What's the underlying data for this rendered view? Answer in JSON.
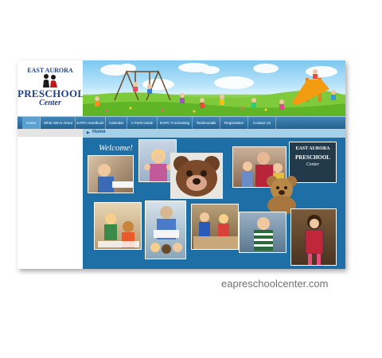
{
  "logo": {
    "line1": "EAST AURORA",
    "line2": "PRESCHOOL",
    "line3": "Center"
  },
  "nav": {
    "items": [
      {
        "label": "Home"
      },
      {
        "label": "What We're About"
      },
      {
        "label": "EAPC Handbook"
      },
      {
        "label": "Calendar"
      },
      {
        "label": "A Peek Inside"
      },
      {
        "label": "EAPC Fundraising"
      },
      {
        "label": "Testimonials"
      },
      {
        "label": "Registration"
      },
      {
        "label": "Contact Us"
      }
    ],
    "active_index": 0
  },
  "breadcrumb": {
    "label": "Home"
  },
  "welcome": {
    "text": "Welcome!"
  },
  "sign": {
    "line1": "EAST AURORA",
    "line2": "PRESCHOOL",
    "line3": "Center"
  },
  "caption": {
    "text": "eapreschoolcenter.com"
  },
  "colors": {
    "nav": "#2d6f9f",
    "content_bg": "#1d6fa6",
    "brand": "#1f3f88"
  }
}
